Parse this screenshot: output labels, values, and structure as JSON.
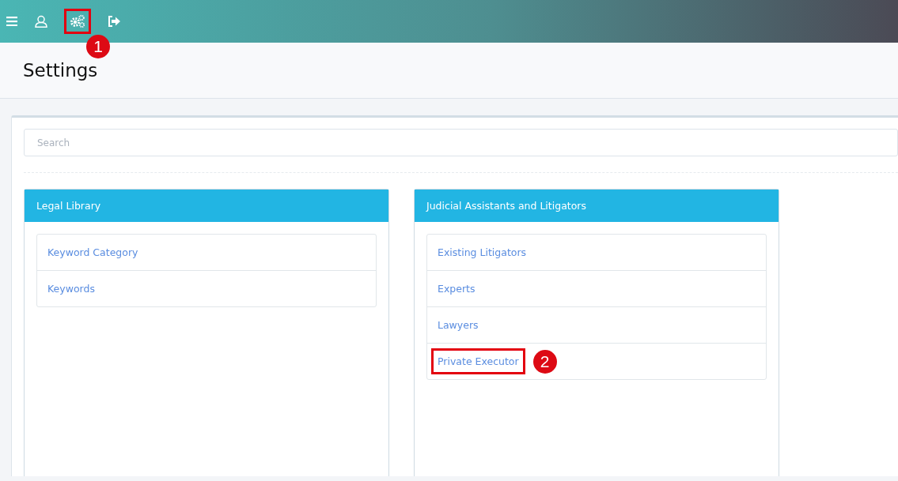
{
  "toolbar": [
    {
      "kind": "menu",
      "highlighted": false
    },
    {
      "kind": "user",
      "highlighted": false
    },
    {
      "kind": "settings",
      "highlighted": true,
      "callout": "1"
    },
    {
      "kind": "logout",
      "highlighted": false
    }
  ],
  "page_title": "Settings",
  "search": {
    "placeholder": "Search"
  },
  "panels": [
    {
      "title": "Legal Library",
      "items": [
        {
          "label": "Keyword Category",
          "highlighted": false
        },
        {
          "label": "Keywords",
          "highlighted": false
        }
      ]
    },
    {
      "title": "Judicial Assistants and Litigators",
      "items": [
        {
          "label": "Existing Litigators",
          "highlighted": false
        },
        {
          "label": "Experts",
          "highlighted": false
        },
        {
          "label": "Lawyers",
          "highlighted": false
        },
        {
          "label": "Private Executor",
          "highlighted": true,
          "callout": "2"
        }
      ]
    }
  ]
}
